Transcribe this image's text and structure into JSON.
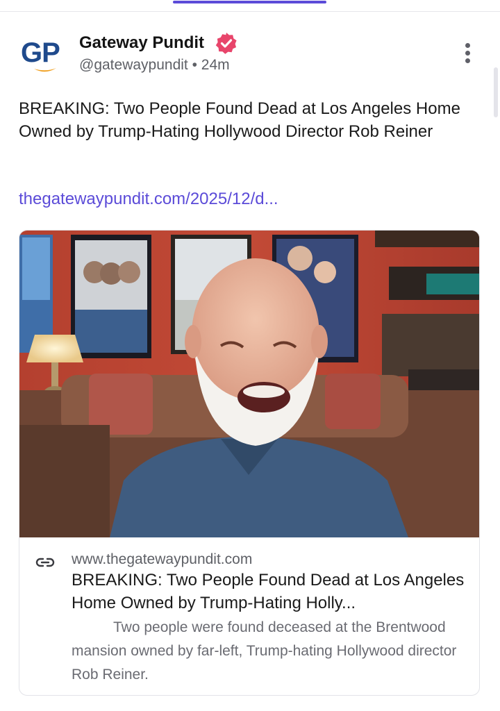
{
  "post": {
    "author": "Gateway Pundit",
    "handle": "@gatewaypundit",
    "time": "24m",
    "avatar_text": "GP",
    "body": "BREAKING: Two People Found Dead at Los Angeles Home Owned by Trump-Hating Hollywood Director Rob Reiner",
    "link": "thegatewaypundit.com/2025/12/d..."
  },
  "card": {
    "domain": "www.thegatewaypundit.com",
    "title": "BREAKING: Two People Found Dead at Los Angeles Home Owned by Trump-Hating Holly...",
    "description": "Two people were found deceased at the Brentwood mansion owned by far-left, Trump-hating Hollywood director Rob Reiner."
  },
  "colors": {
    "accent": "#5b4bd8",
    "verified": "#e8456b",
    "brand_blue": "#1f4a8c",
    "brand_orange": "#f0a020"
  },
  "icons": {
    "verified": "verified-badge-icon",
    "more": "more-vertical-icon",
    "link": "link-icon"
  }
}
